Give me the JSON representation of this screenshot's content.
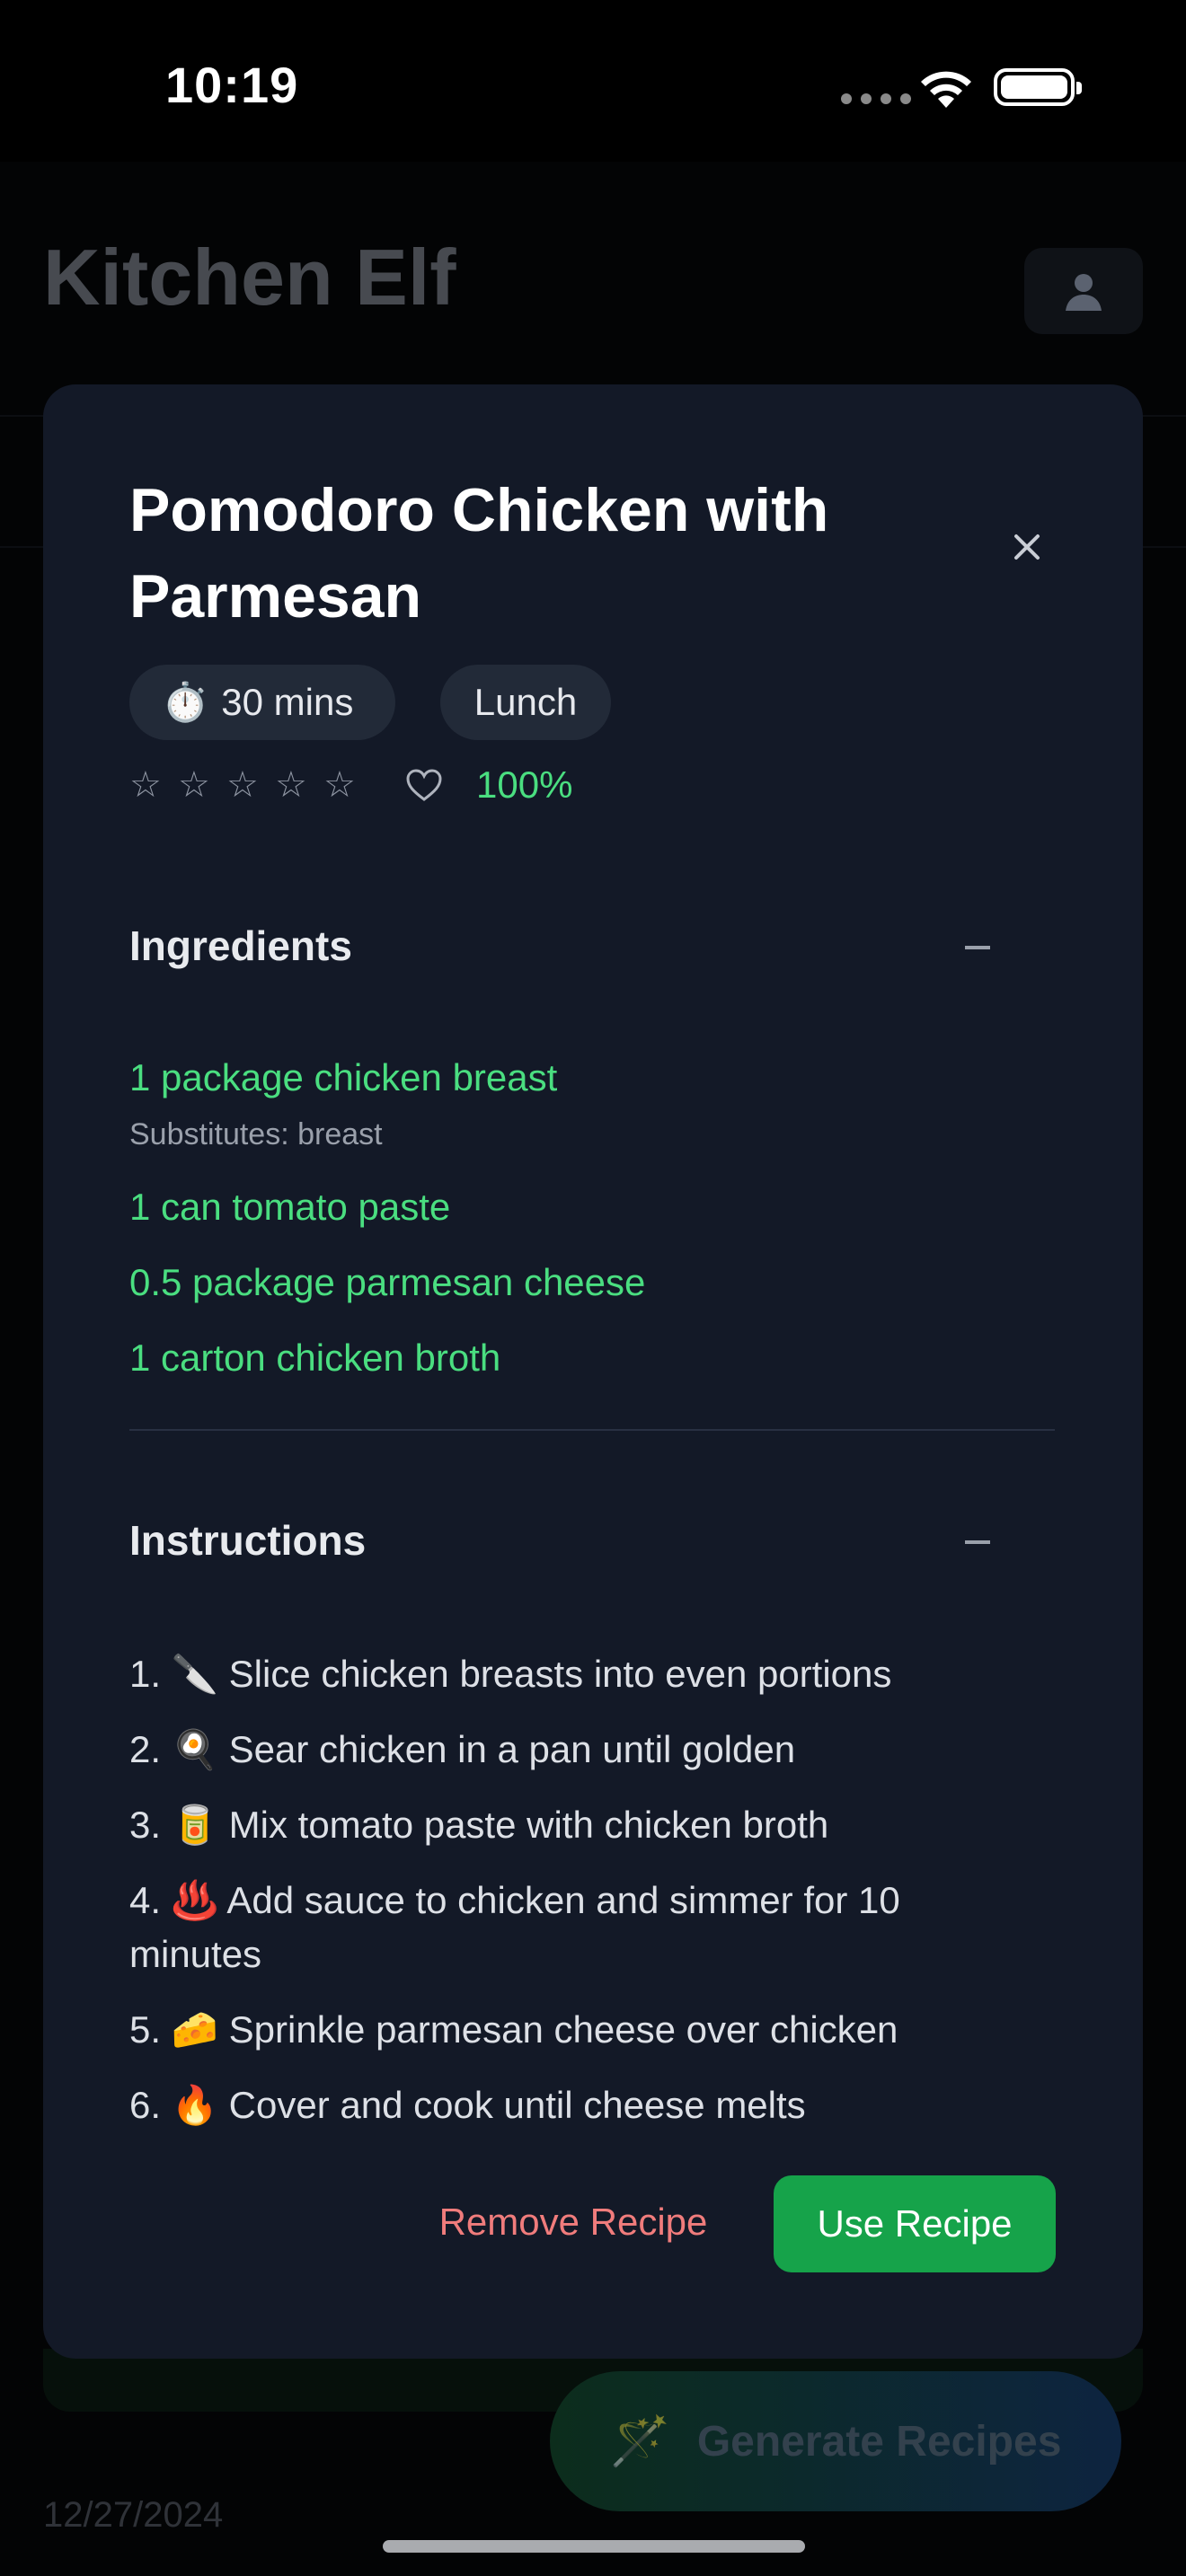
{
  "status_bar": {
    "time": "10:19"
  },
  "app": {
    "title": "Kitchen Elf",
    "footer_date": "12/27/2024",
    "generate_label": "Generate Recipes",
    "generate_icon": "🪄"
  },
  "modal": {
    "title": "Pomodoro Chicken with Parmesan",
    "time_icon": "⏱️",
    "time": "30 mins",
    "meal_type": "Lunch",
    "stars": [
      "☆",
      "☆",
      "☆",
      "☆",
      "☆"
    ],
    "rating_value": 0,
    "match": "100%",
    "ingredients_heading": "Ingredients",
    "ingredients": [
      {
        "text": "1 package chicken breast",
        "substitutes": "Substitutes: breast"
      },
      {
        "text": "1 can tomato paste"
      },
      {
        "text": "0.5 package parmesan cheese"
      },
      {
        "text": "1 carton chicken broth"
      }
    ],
    "instructions_heading": "Instructions",
    "instructions": [
      "1. 🔪 Slice chicken breasts into even portions",
      "2. 🍳 Sear chicken in a pan until golden",
      "3. 🥫 Mix tomato paste with chicken broth",
      "4. ♨️ Add sauce to chicken and simmer for 10 minutes",
      "5. 🧀 Sprinkle parmesan cheese over chicken",
      "6. 🔥 Cover and cook until cheese melts"
    ],
    "remove_label": "Remove Recipe",
    "use_label": "Use Recipe"
  },
  "colors": {
    "modal_bg": "#131927",
    "accent_green": "#4ade80",
    "use_button": "#16a34a",
    "remove_text": "#f07c7c"
  }
}
